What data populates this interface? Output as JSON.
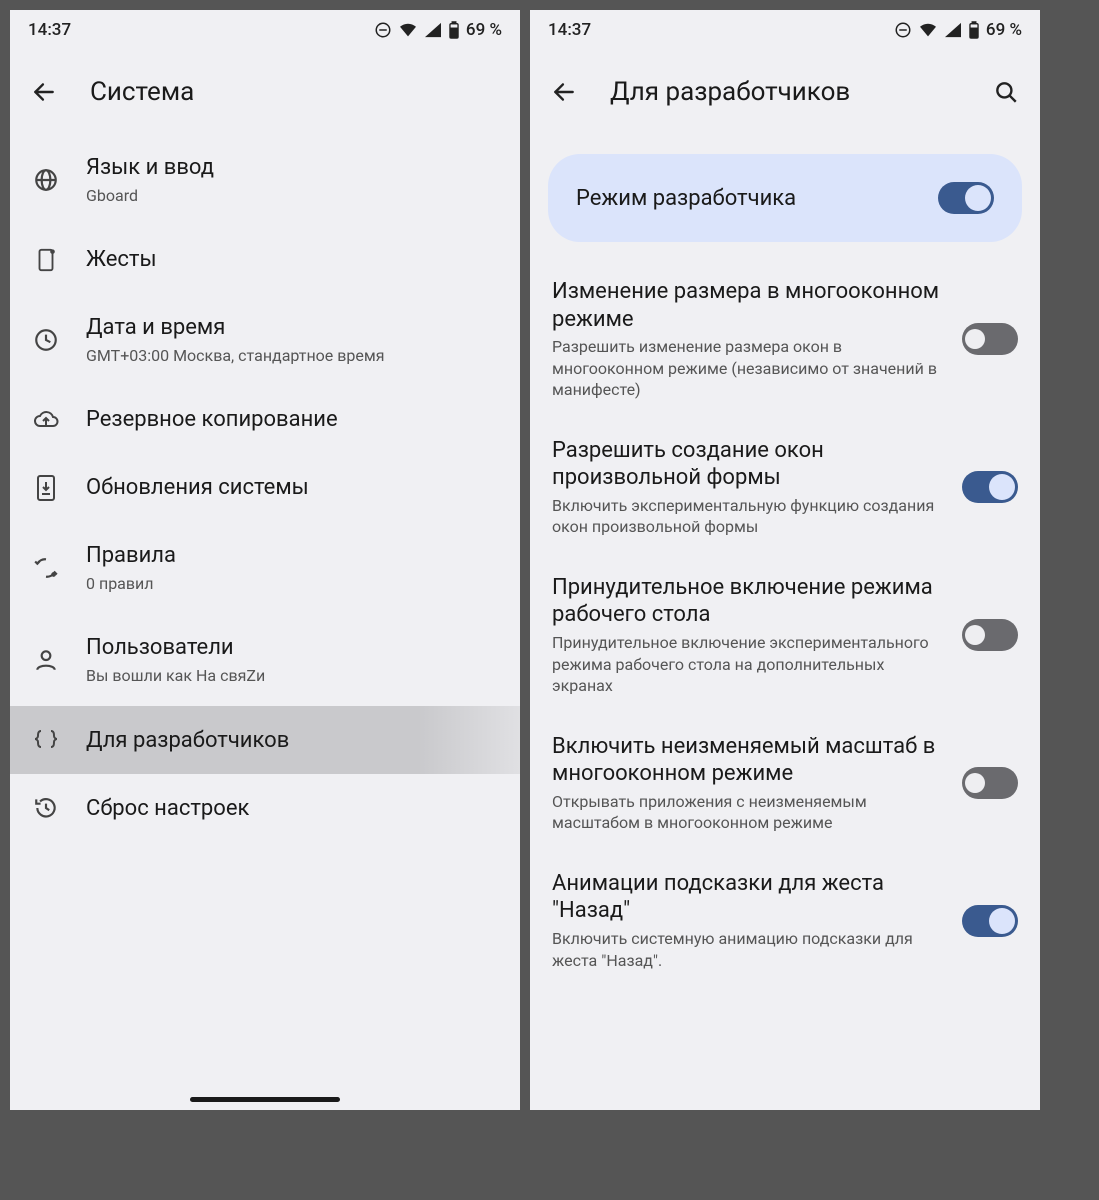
{
  "status": {
    "time": "14:37",
    "battery": "69 %"
  },
  "screen1": {
    "title": "Система",
    "items": [
      {
        "title": "Язык и ввод",
        "sub": "Gboard"
      },
      {
        "title": "Жесты",
        "sub": ""
      },
      {
        "title": "Дата и время",
        "sub": "GMT+03:00 Москва, стандартное время"
      },
      {
        "title": "Резервное копирование",
        "sub": ""
      },
      {
        "title": "Обновления системы",
        "sub": ""
      },
      {
        "title": "Правила",
        "sub": "0 правил"
      },
      {
        "title": "Пользователи",
        "sub": "Вы вошли как На свяZи"
      },
      {
        "title": "Для разработчиков",
        "sub": ""
      },
      {
        "title": "Сброс настроек",
        "sub": ""
      }
    ]
  },
  "screen2": {
    "title": "Для разработчиков",
    "devMode": {
      "label": "Режим разработчика",
      "on": true
    },
    "items": [
      {
        "title": "Изменение размера в многооконном режиме",
        "sub": "Разрешить изменение размера окон в многооконном режиме (независимо от значений в манифесте)",
        "on": false
      },
      {
        "title": "Разрешить создание окон произвольной формы",
        "sub": "Включить экспериментальную функцию создания окон произвольной формы",
        "on": true
      },
      {
        "title": "Принудительное включение режима рабочего стола",
        "sub": "Принудительное включение экспериментального режима рабочего стола на дополнительных экранах",
        "on": false
      },
      {
        "title": "Включить неизменяемый масштаб в многооконном режиме",
        "sub": "Открывать приложения с неизменяемым масштабом в многооконном режиме",
        "on": false
      },
      {
        "title": "Анимации подсказки для жеста \"Назад\"",
        "sub": "Включить системную анимацию подсказки для жеста \"Назад\".",
        "on": true
      }
    ]
  }
}
